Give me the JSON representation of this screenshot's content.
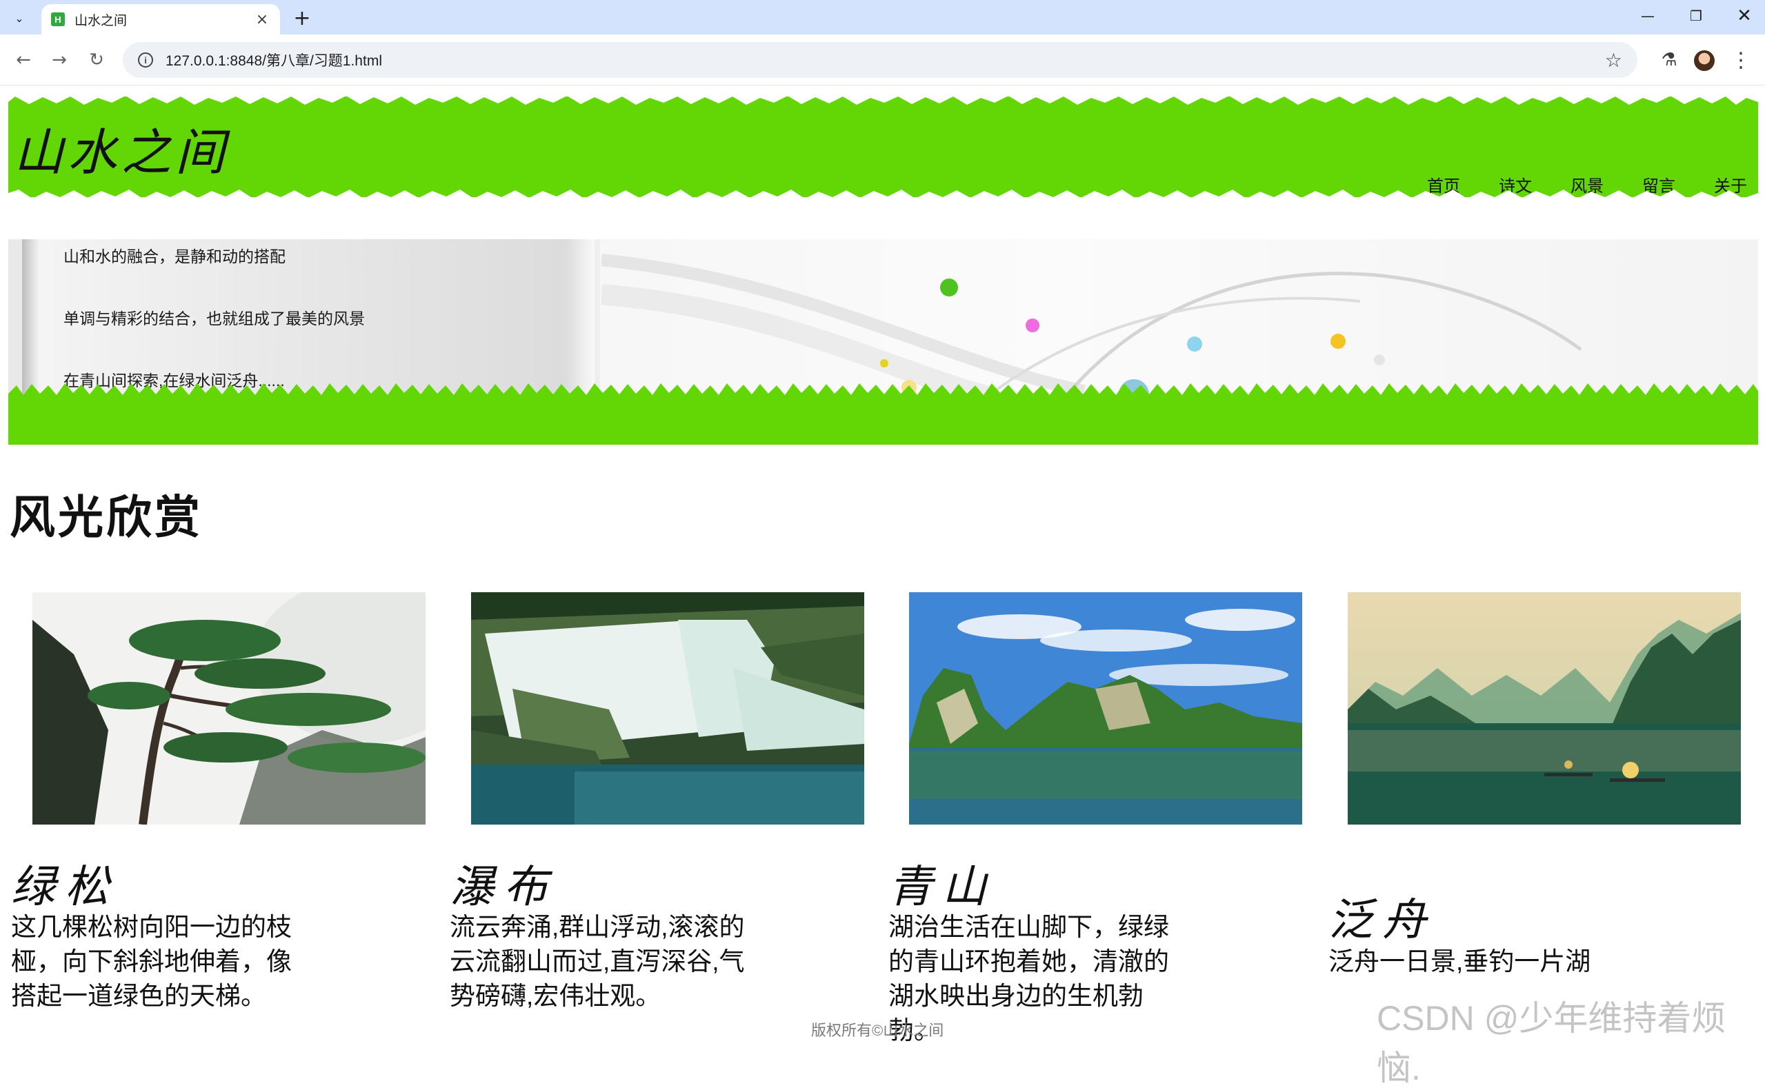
{
  "browser": {
    "tab_title": "山水之间",
    "favicon_letter": "H",
    "url": "127.0.0.1:8848/第八章/习题1.html"
  },
  "site": {
    "title": "山水之间",
    "nav": [
      "首页",
      "诗文",
      "风景",
      "留言",
      "关于"
    ]
  },
  "banner": {
    "lines": [
      "山和水的融合，是静和动的搭配",
      "单调与精彩的结合，也就组成了最美的风景",
      "在青山间探索,在绿水间泛舟......"
    ]
  },
  "gallery": {
    "section_title": "风光欣赏",
    "cards": [
      {
        "title": "绿松",
        "image": "pine-tree",
        "desc_lines": [
          "这几棵松树向阳一边的枝",
          "桠，向下斜斜地伸着，像",
          "搭起一道绿色的天梯。"
        ]
      },
      {
        "title": "瀑布",
        "image": "waterfall",
        "desc_lines": [
          "流云奔涌,群山浮动,滚滚的",
          "云流翻山而过,直泻深谷,气",
          "势磅礴,宏伟壮观。"
        ]
      },
      {
        "title": "青山",
        "image": "green-mountains",
        "desc_lines": [
          "湖治生活在山脚下，绿绿",
          "的青山环抱着她，清澈的",
          "湖水映出身边的生机勃勃。"
        ]
      },
      {
        "title": "泛舟",
        "image": "boating",
        "desc_lines": [
          "泛舟一日景,垂钓一片湖"
        ]
      }
    ]
  },
  "footer": {
    "text": "版权所有©山水之间"
  },
  "watermark": {
    "text": "CSDN @少年维持着烦恼."
  },
  "colors": {
    "grass": "#63d605",
    "tabbar": "#d3e3fd"
  }
}
